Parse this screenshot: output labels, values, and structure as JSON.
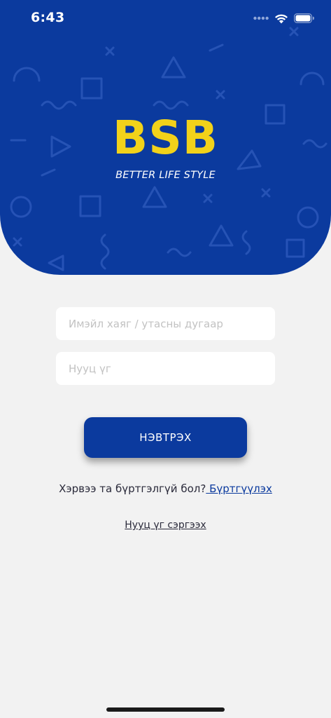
{
  "status_bar": {
    "time": "6:43",
    "icons": [
      "signal-dots-icon",
      "wifi-icon",
      "battery-icon"
    ]
  },
  "brand": {
    "logo_text": "BSB",
    "tagline": "BETTER LIFE STYLE",
    "colors": {
      "primary": "#0b3a9e",
      "logo": "#f2d21a",
      "background": "#f2f2f2"
    }
  },
  "form": {
    "login_placeholder": "Имэйл хаяг / утасны дугаар",
    "login_value": "",
    "password_placeholder": "Нууц үг",
    "password_value": "",
    "submit_label": "НЭВТРЭХ"
  },
  "register": {
    "prompt": "Хэрвээ та бүртгэлгүй бол?",
    "link_label": " Бүртгүүлэх"
  },
  "forgot": {
    "link_label": "Нууц үг сэргээх"
  }
}
